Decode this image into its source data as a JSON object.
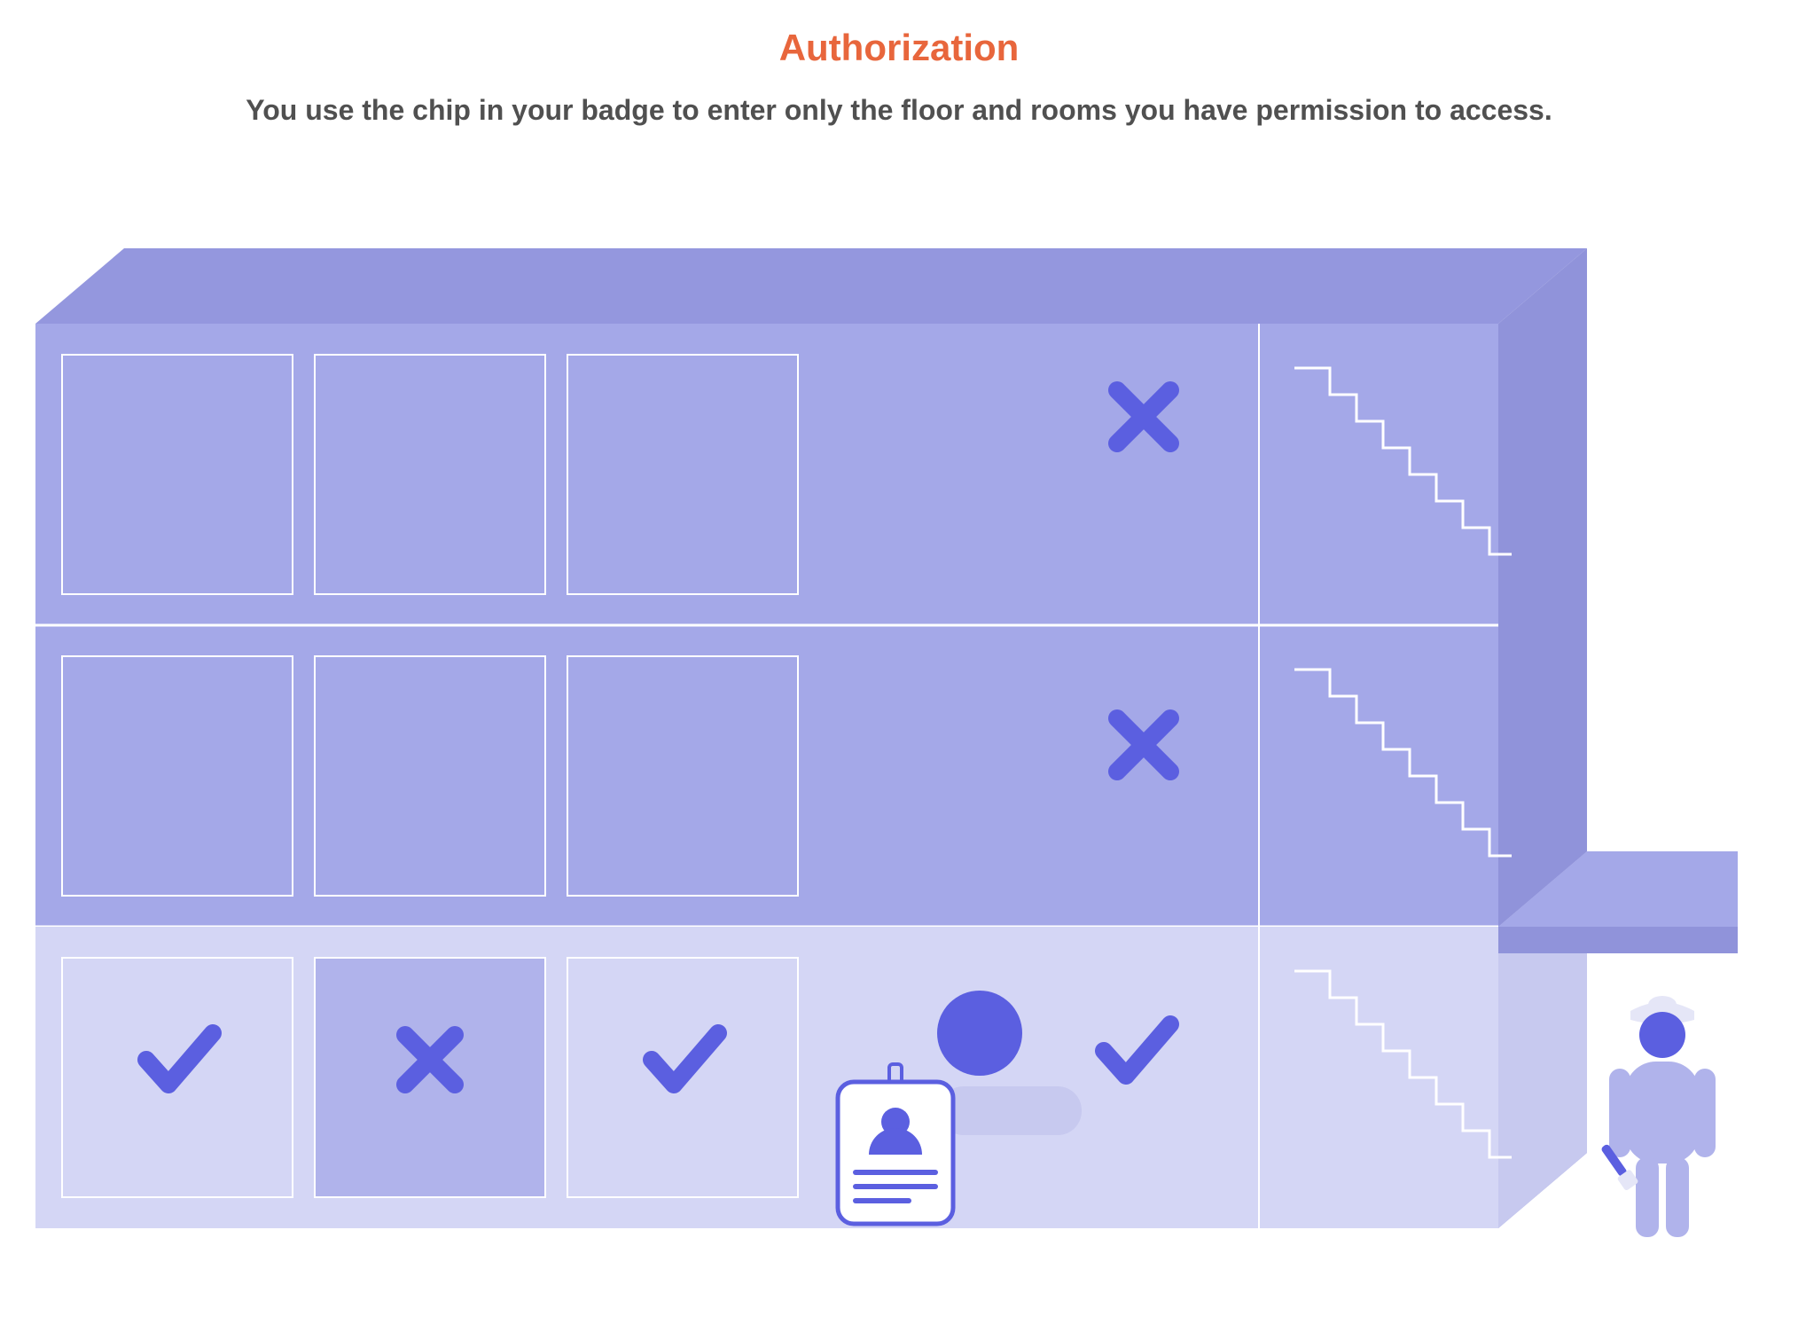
{
  "title": "Authorization",
  "subtitle": "You use the chip in your badge to enter only the floor and rooms you have permission to access.",
  "colors": {
    "accent": "#E8663C",
    "text": "#505050",
    "building_upper": "#A4A8E8",
    "building_ground": "#D4D6F5",
    "outline": "#FFFFFF",
    "icon": "#5B5FE0",
    "denied_room": "#B0B3EB",
    "guard_body": "#B0B3EB",
    "guard_dark": "#5B5FE0"
  },
  "floors": [
    {
      "name": "floor-3",
      "authorized": false,
      "rooms": [
        {
          "status": "none"
        },
        {
          "status": "none"
        },
        {
          "status": "none"
        }
      ]
    },
    {
      "name": "floor-2",
      "authorized": false,
      "rooms": [
        {
          "status": "none"
        },
        {
          "status": "none"
        },
        {
          "status": "none"
        }
      ]
    },
    {
      "name": "floor-1",
      "authorized": true,
      "rooms": [
        {
          "status": "allowed"
        },
        {
          "status": "denied"
        },
        {
          "status": "allowed"
        }
      ]
    }
  ],
  "floor_entry_status": {
    "floor-3": "denied",
    "floor-2": "denied",
    "floor-1": "allowed"
  }
}
